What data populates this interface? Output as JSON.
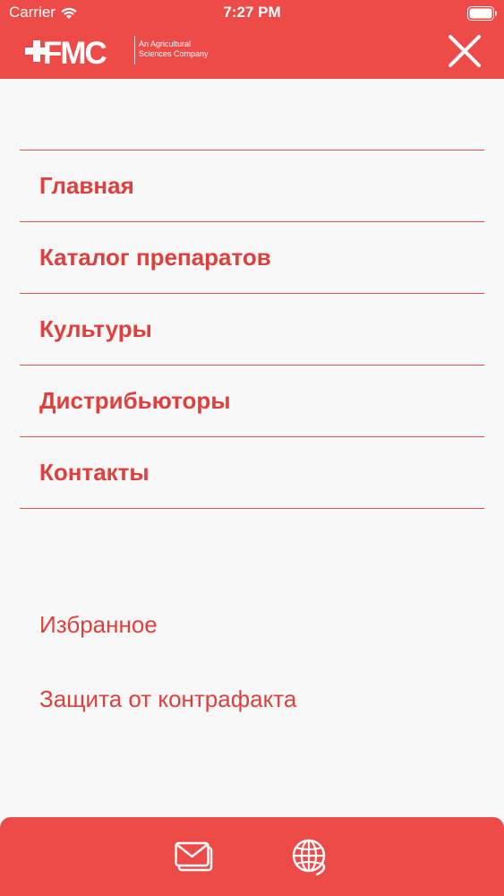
{
  "status_bar": {
    "carrier": "Carrier",
    "time": "7:27 PM",
    "wifi_icon": "wifi-icon",
    "battery_icon": "battery-icon"
  },
  "header": {
    "logo": {
      "brand": "FMC",
      "tagline_line1": "An Agricultural",
      "tagline_line2": "Sciences Company"
    },
    "close_icon": "close-icon",
    "background_color": "#ee4a47"
  },
  "menu": {
    "items": [
      {
        "label": "Главная"
      },
      {
        "label": "Каталог препаратов"
      },
      {
        "label": "Культуры"
      },
      {
        "label": "Дистрибьюторы"
      },
      {
        "label": "Контакты"
      }
    ],
    "text_color": "#e0403d"
  },
  "secondary_links": {
    "items": [
      {
        "label": "Избранное"
      },
      {
        "label": "Защита от контрафакта"
      }
    ]
  },
  "bottom_bar": {
    "mail_icon": "mail-icon",
    "globe_icon": "globe-icon"
  }
}
